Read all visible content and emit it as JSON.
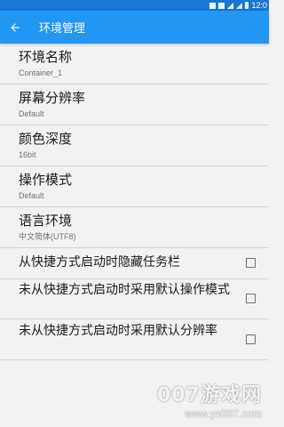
{
  "status_bar": {
    "time": "12:0",
    "icons": [
      "notification-icon",
      "notification-icon",
      "wifi-icon",
      "signal-icon",
      "battery-icon"
    ]
  },
  "app_bar": {
    "title": "环境管理",
    "back_icon": "arrow-back-icon"
  },
  "settings": [
    {
      "title": "环境名称",
      "value": "Container_1"
    },
    {
      "title": "屏幕分辨率",
      "value": "Default"
    },
    {
      "title": "颜色深度",
      "value": "16bit"
    },
    {
      "title": "操作模式",
      "value": "Default"
    },
    {
      "title": "语言环境",
      "value": "中文简体(UTF8)"
    }
  ],
  "checkbox_options": [
    {
      "label": "从快捷方式启动时隐藏任务栏",
      "checked": false
    },
    {
      "label": "未从快捷方式启动时采用默认操作模式",
      "checked": false
    },
    {
      "label": "未从快捷方式启动时采用默认分辨率",
      "checked": false
    }
  ],
  "watermark": {
    "logo_text": "007游戏网",
    "url": "www.yx007.com"
  },
  "colors": {
    "status_bar": "#1976d2",
    "app_bar": "#2196f3",
    "background": "#f2f2f2",
    "divider": "#d6d6d6"
  }
}
